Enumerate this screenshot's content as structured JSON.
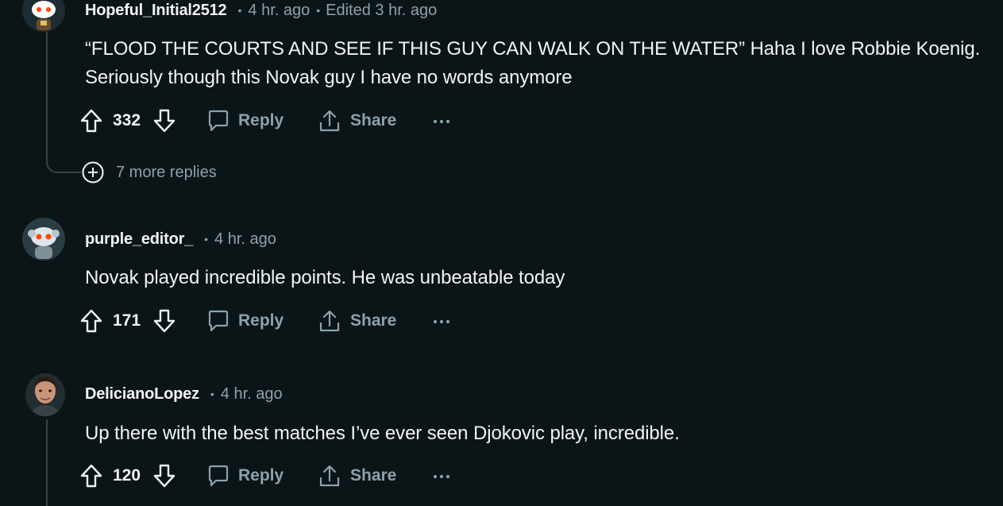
{
  "comments": [
    {
      "username": "Hopeful_Initial2512",
      "time": "4 hr. ago",
      "edited": "Edited 3 hr. ago",
      "body_lines": [
        "“FLOOD THE COURTS AND SEE IF THIS GUY CAN WALK ON THE WATER” Haha I love Robbie Koenig.",
        "Seriously though this Novak guy I have no words anymore"
      ],
      "votes": "332",
      "reply_label": "Reply",
      "share_label": "Share",
      "more_replies": "7 more replies"
    },
    {
      "username": "purple_editor_",
      "time": "4 hr. ago",
      "body_lines": [
        "Novak played incredible points. He was unbeatable today"
      ],
      "votes": "171",
      "reply_label": "Reply",
      "share_label": "Share"
    },
    {
      "username": "DelicianoLopez",
      "time": "4 hr. ago",
      "body_lines": [
        "Up there with the best matches I’ve ever seen Djokovic play, incredible."
      ],
      "votes": "120",
      "reply_label": "Reply",
      "share_label": "Share"
    }
  ],
  "icons": {
    "upvote": "arrow-up-outline-icon",
    "downvote": "arrow-down-outline-icon",
    "reply": "speech-bubble-icon",
    "share": "share-upload-icon",
    "more": "ellipsis-icon",
    "expand": "plus-circle-icon"
  },
  "colors": {
    "background": "#0b1416",
    "text": "#f2f4f5",
    "muted": "#8ba2ad",
    "thread_line": "#33464c"
  }
}
